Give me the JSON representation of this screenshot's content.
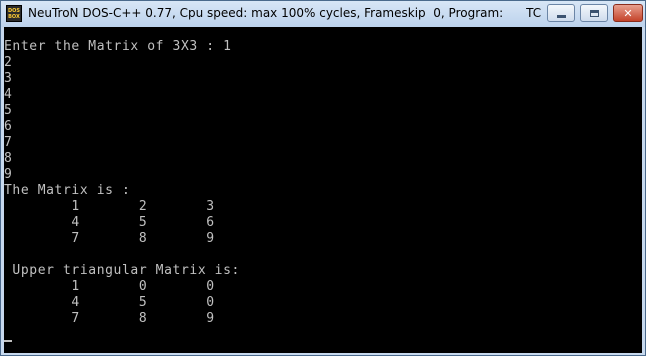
{
  "window": {
    "title": "NeuTroN DOS-C++ 0.77, Cpu speed: max 100% cycles, Frameskip  0, Program:      TC",
    "icon": {
      "name": "dosbox-icon",
      "line1": "DOS",
      "line2": "BOX"
    },
    "controls": {
      "minimize": "minimize-icon",
      "maximize": "maximize-icon",
      "close_label": "✕"
    }
  },
  "console": {
    "lines": [
      "Enter the Matrix of 3X3 : 1",
      "2",
      "3",
      "4",
      "5",
      "6",
      "7",
      "8",
      "9",
      "The Matrix is :",
      "        1       2       3",
      "        4       5       6",
      "        7       8       9",
      "",
      " Upper triangular Matrix is:",
      "        1       0       0",
      "        4       5       0",
      "        7       8       9"
    ],
    "cursor": "_"
  },
  "colors": {
    "console_bg": "#000000",
    "console_fg": "#c0c0c0",
    "titlebar": "#c7d9ee",
    "close_button": "#c4432a"
  }
}
